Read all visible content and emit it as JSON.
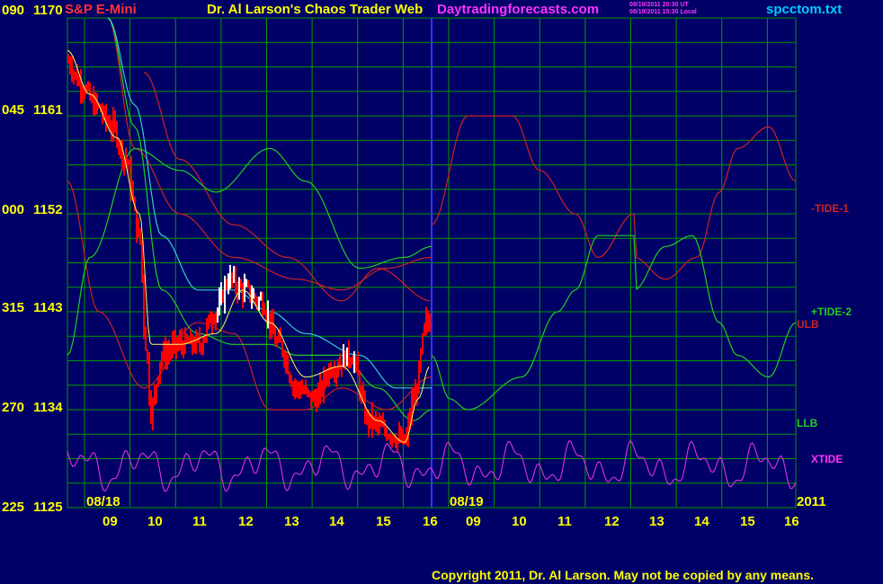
{
  "header": {
    "symbol": "S&P E-Mini",
    "title": "Dr. Al Larson's Chaos Trader Web",
    "site": "Daytradingforecasts.com",
    "stamp_ut": "08/19/2011 20:30 UT",
    "stamp_local": "08/19/2011 15:30 Local",
    "file": "spcctom.txt"
  },
  "footer": {
    "copyright": "Copyright 2011, Dr. Al Larson. May not be copied by any means."
  },
  "colors": {
    "background": "#000066",
    "grid": "#009900",
    "price_up": "#ffffff",
    "price_down": "#ff0000",
    "tide1": "#cc2222",
    "tide2": "#22cc22",
    "xtide": "#dd33dd",
    "divider": "#3333ff",
    "label_yellow": "#ffff00",
    "label_magenta": "#ff33ff",
    "label_cyan": "#00ccff"
  },
  "chart_data": {
    "type": "line",
    "ylim": [
      1125,
      1170
    ],
    "y_ticks": [
      {
        "value": 1170,
        "label": "1170",
        "angle": "090"
      },
      {
        "value": 1161,
        "label": "1161",
        "angle": "045"
      },
      {
        "value": 1152,
        "label": "1152",
        "angle": "000"
      },
      {
        "value": 1143,
        "label": "1143",
        "angle": "315"
      },
      {
        "value": 1134,
        "label": "1134",
        "angle": "270"
      },
      {
        "value": 1125,
        "label": "1125",
        "angle": "225"
      }
    ],
    "x_ticks": [
      "09",
      "10",
      "11",
      "12",
      "13",
      "14",
      "15",
      "16",
      "09",
      "10",
      "11",
      "12",
      "13",
      "14",
      "15",
      "16"
    ],
    "date_labels": [
      "08/18",
      "08/19"
    ],
    "year_label": "2011",
    "series": [
      {
        "name": "-TIDE-1",
        "values": [
          1151,
          1161,
          1162,
          1161,
          1160,
          1158,
          1160,
          1158,
          1153,
          1150,
          1148,
          1152,
          1154,
          1149,
          1146,
          1150,
          1156,
          1158,
          1157,
          1155
        ]
      },
      {
        "name": "+TIDE-2",
        "values": [
          1139,
          1150,
          1156,
          1155,
          1153,
          1151,
          1149,
          1152,
          1149,
          1147,
          1140,
          1143,
          1140,
          1139,
          1138,
          1136,
          1134,
          1134,
          1140,
          1142
        ]
      },
      {
        "name": "ULB",
        "values": []
      },
      {
        "name": "LLB",
        "values": []
      },
      {
        "name": "XTIDE",
        "values": []
      }
    ]
  }
}
